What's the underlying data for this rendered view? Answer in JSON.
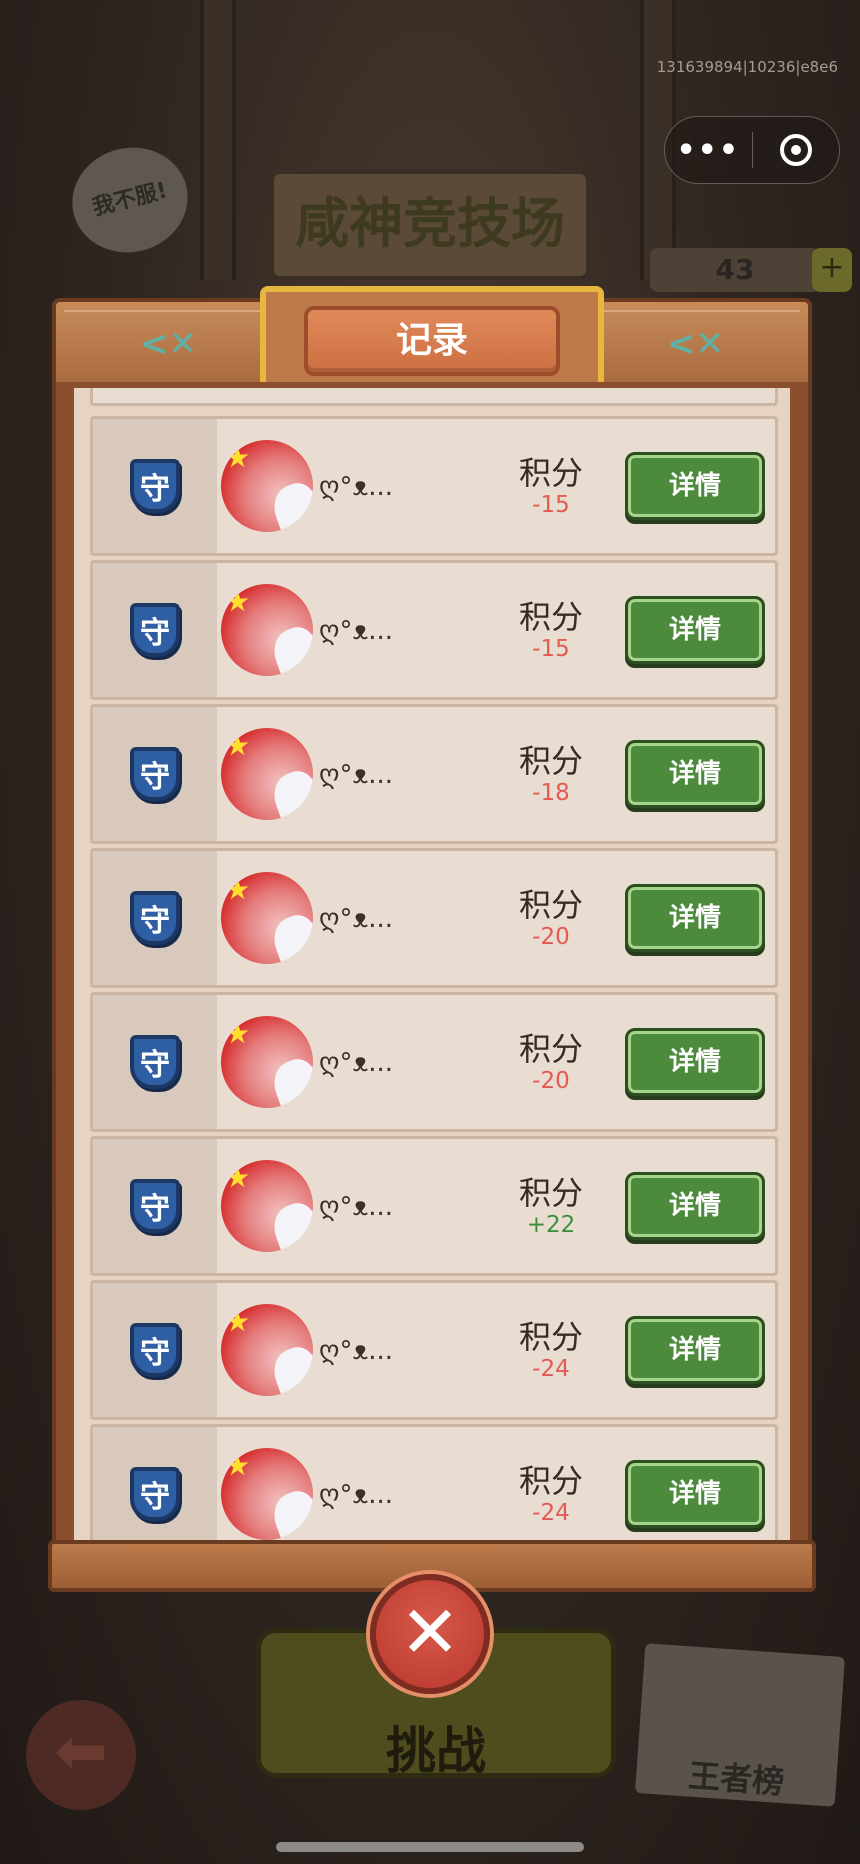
{
  "system": {
    "debug_id": "131639894|10236|e8e6",
    "menu_icon": "more-dots-icon",
    "close_icon": "target-circle-icon"
  },
  "background": {
    "arena_title": "咸神竞技场",
    "speech_bubble": "我不服!",
    "coins": "43",
    "coin_plus": "+",
    "challenge_label": "挑战",
    "rank_label": "王者榜",
    "back_icon": "arrow-left-icon"
  },
  "dialog": {
    "title": "记录",
    "decor_icon": "fish-icon",
    "close_icon": "close-x-icon",
    "records": [
      {
        "role": "守",
        "nickname": "ღ°ᴥ...",
        "score_label": "积分",
        "score": "-15",
        "sign": "neg",
        "detail_label": "详情"
      },
      {
        "role": "守",
        "nickname": "ღ°ᴥ...",
        "score_label": "积分",
        "score": "-15",
        "sign": "neg",
        "detail_label": "详情"
      },
      {
        "role": "守",
        "nickname": "ღ°ᴥ...",
        "score_label": "积分",
        "score": "-18",
        "sign": "neg",
        "detail_label": "详情"
      },
      {
        "role": "守",
        "nickname": "ღ°ᴥ...",
        "score_label": "积分",
        "score": "-20",
        "sign": "neg",
        "detail_label": "详情"
      },
      {
        "role": "守",
        "nickname": "ღ°ᴥ...",
        "score_label": "积分",
        "score": "-20",
        "sign": "neg",
        "detail_label": "详情"
      },
      {
        "role": "守",
        "nickname": "ღ°ᴥ...",
        "score_label": "积分",
        "score": "+22",
        "sign": "pos",
        "detail_label": "详情"
      },
      {
        "role": "守",
        "nickname": "ღ°ᴥ...",
        "score_label": "积分",
        "score": "-24",
        "sign": "neg",
        "detail_label": "详情"
      },
      {
        "role": "守",
        "nickname": "ღ°ᴥ...",
        "score_label": "积分",
        "score": "-24",
        "sign": "neg",
        "detail_label": "详情"
      }
    ]
  }
}
